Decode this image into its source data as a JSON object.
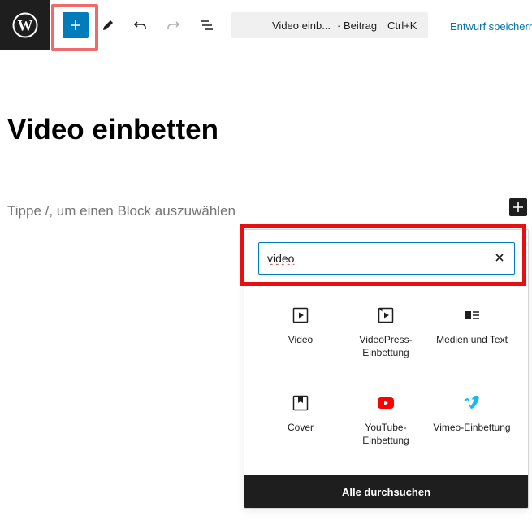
{
  "toolbar": {
    "add_block_tooltip": "+",
    "document_title": "Video einb...",
    "document_type": "· Beitrag",
    "shortcut": "Ctrl+K",
    "save_draft_label": "Entwurf speichern"
  },
  "editor": {
    "post_title": "Video einbetten",
    "block_placeholder": "Tippe /, um einen Block auszuwählen"
  },
  "inserter": {
    "search_value": "video",
    "blocks": [
      {
        "label": "Video",
        "icon": "video-icon"
      },
      {
        "label": "VideoPress-Einbettung",
        "icon": "videopress-icon"
      },
      {
        "label": "Medien und Text",
        "icon": "media-text-icon"
      },
      {
        "label": "Cover",
        "icon": "cover-icon"
      },
      {
        "label": "YouTube-Einbettung",
        "icon": "youtube-icon"
      },
      {
        "label": "Vimeo-Einbettung",
        "icon": "vimeo-icon"
      }
    ],
    "browse_all_label": "Alle durchsuchen"
  },
  "colors": {
    "accent": "#007cba",
    "highlight_soft": "#ef6a6a",
    "highlight_strong": "#e61010",
    "youtube_red": "#ff0000",
    "vimeo_blue": "#1ab7ea"
  }
}
